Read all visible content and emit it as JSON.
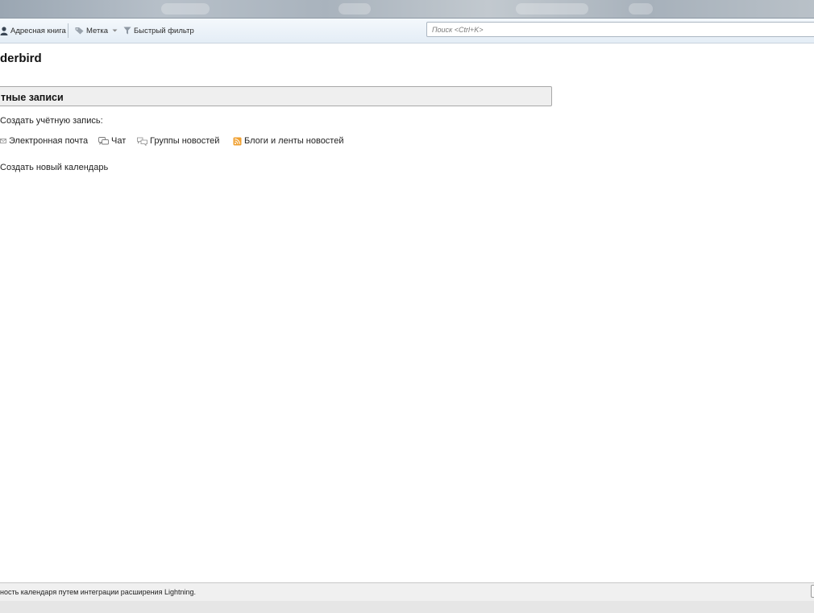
{
  "toolbar": {
    "address_book": "Адресная книга",
    "tag": "Метка",
    "quick_filter": "Быстрый фильтр",
    "search_placeholder": "Поиск <Ctrl+K>"
  },
  "main": {
    "app_title": "derbird",
    "accounts_section": "тные записи",
    "create_account_label": "Создать учётную запись:",
    "account_types": [
      {
        "label": "Электронная почта",
        "icon": "email-icon"
      },
      {
        "label": "Чат",
        "icon": "chat-icon"
      },
      {
        "label": "Группы новостей",
        "icon": "newsgroup-icon"
      },
      {
        "label": "Блоги и ленты новостей",
        "icon": "rss-icon"
      }
    ],
    "new_calendar": "Создать новый календарь"
  },
  "statusbar": {
    "text": "ность календаря путем интеграции расширения Lightning."
  },
  "colors": {
    "toolbar_bg": "#e4edf6",
    "rss_accent": "#f0a030"
  }
}
